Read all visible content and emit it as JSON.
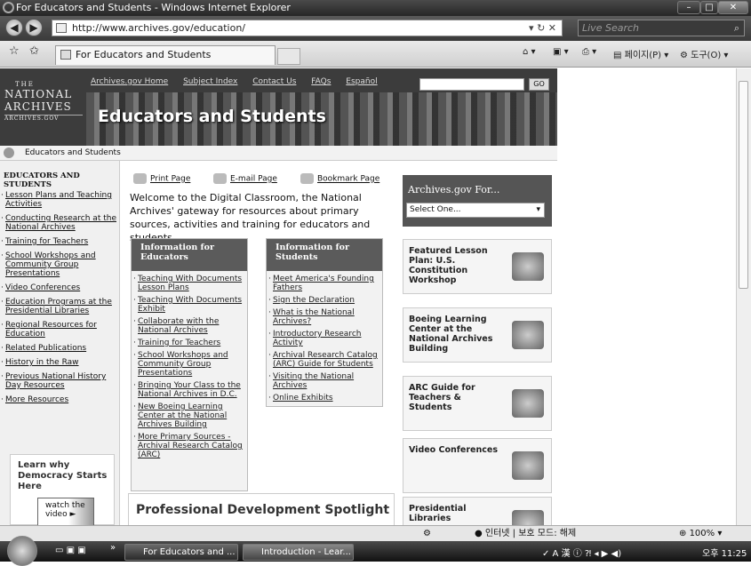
{
  "window": {
    "title": "For Educators and Students - Windows Internet Explorer",
    "url": "http://www.archives.gov/education/",
    "search_placeholder": "Live Search",
    "tab_title": "For Educators and Students",
    "toolbar_page": "페이지(P)",
    "toolbar_tools": "도구(O)"
  },
  "header": {
    "nav": [
      "Archives.gov Home",
      "Subject Index",
      "Contact Us",
      "FAQs",
      "Español"
    ],
    "logo_line1": "THE",
    "logo_line2": "NATIONAL",
    "logo_line3": "ARCHIVES",
    "logo_line4": "ARCHIVES.GOV",
    "title": "Educators and Students",
    "go_label": "GO"
  },
  "breadcrumb": "Educators and Students",
  "sidebar": {
    "heading": "EDUCATORS AND STUDENTS",
    "items": [
      "Lesson Plans and Teaching Activities",
      "Conducting Research at the National Archives",
      "Training for Teachers",
      "School Workshops and Community Group Presentations",
      "Video Conferences",
      "Education Programs at the Presidential Libraries",
      "Regional Resources for Education",
      "Related Publications",
      "History in the Raw",
      "Previous National History Day Resources",
      "More Resources"
    ],
    "promo_text": "Learn why Democracy Starts Here",
    "promo_button": "watch the video ►"
  },
  "main": {
    "tools": [
      "Print Page",
      "E-mail Page",
      "Bookmark Page"
    ],
    "welcome": "Welcome to the Digital Classroom, the National Archives' gateway for resources about primary sources, activities and training for educators and students.",
    "educators_heading": "Information for Educators",
    "educators_links": [
      "Teaching With Documents Lesson Plans",
      "Teaching With Documents Exhibit",
      "Collaborate with the National Archives",
      "Training for Teachers",
      "School Workshops and Community Group Presentations",
      "Bringing Your Class to the National Archives in D.C.",
      "New Boeing Learning Center at the National Archives Building",
      "More Primary Sources - Archival Research Catalog (ARC)"
    ],
    "students_heading": "Information for Students",
    "students_links": [
      "Meet America's Founding Fathers",
      "Sign the Declaration",
      "What is the National Archives?",
      "Introductory Research Activity",
      "Archival Research Catalog (ARC) Guide for Students",
      "Visiting the National Archives",
      "Online Exhibits"
    ],
    "spotlight": "Professional Development Spotlight"
  },
  "right": {
    "archives_for": "Archives.gov For...",
    "select_value": "Select One...",
    "features": [
      "Featured Lesson Plan: U.S. Constitution Workshop",
      "Boeing Learning Center at the National Archives Building",
      "ARC Guide for Teachers & Students",
      "Video Conferences",
      "Presidential Libraries"
    ]
  },
  "status": {
    "zone": "인터넷 | 보호 모드: 해제",
    "zoom": "100%"
  },
  "taskbar": {
    "tasks": [
      "For Educators and ...",
      "Introduction - Lear..."
    ],
    "clock": "오후 11:25"
  }
}
